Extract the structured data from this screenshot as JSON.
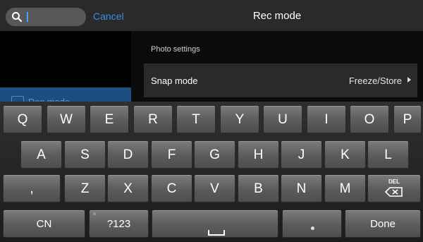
{
  "search": {
    "value": "",
    "placeholder": "",
    "cancel_label": "Cancel"
  },
  "header": {
    "title": "Rec mode"
  },
  "sidebar": {
    "selected_item_label": "Rec mode"
  },
  "settings": {
    "section_title": "Photo settings",
    "snap_mode": {
      "label": "Snap mode",
      "value": "Freeze/Store"
    }
  },
  "keyboard": {
    "row1": [
      "Q",
      "W",
      "E",
      "R",
      "T",
      "Y",
      "U",
      "I",
      "O",
      "P"
    ],
    "row2": [
      "A",
      "S",
      "D",
      "F",
      "G",
      "H",
      "J",
      "K",
      "L"
    ],
    "row3": [
      ",",
      "Z",
      "X",
      "C",
      "V",
      "B",
      "N",
      "M"
    ],
    "del_label": "DEL",
    "cn_label": "CN",
    "num_label": "?123",
    "done_label": "Done"
  }
}
